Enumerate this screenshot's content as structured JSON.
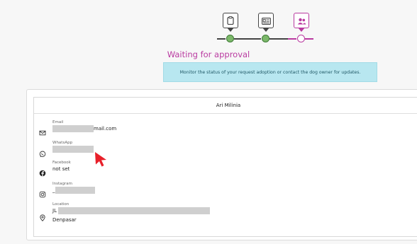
{
  "stepper": {
    "steps": [
      {
        "icon": "clipboard-icon",
        "state": "done"
      },
      {
        "icon": "id-card-icon",
        "state": "done"
      },
      {
        "icon": "users-icon",
        "state": "current"
      }
    ]
  },
  "status": {
    "title": "Waiting for approval",
    "message": "Monitor the status of your request adoption or contact the dog owner for updates."
  },
  "contact": {
    "owner_name": "Ari Milinia",
    "email": {
      "label": "Email",
      "value_suffix": "mail.com",
      "icon": "mail-icon"
    },
    "whatsapp": {
      "label": "WhatsApp",
      "icon": "whatsapp-icon"
    },
    "facebook": {
      "label": "Facebook",
      "value": "not set",
      "icon": "facebook-icon"
    },
    "instagram": {
      "label": "Instagram",
      "value_prefix": "_",
      "icon": "instagram-icon"
    },
    "location": {
      "label": "Location",
      "value_prefix": "JL",
      "city": "Denpasar",
      "icon": "map-pin-icon"
    }
  },
  "colors": {
    "accent": "#b93aa0",
    "done": "#7cb86a",
    "alert_bg": "#b8e7f0",
    "cursor": "#e8202a"
  }
}
